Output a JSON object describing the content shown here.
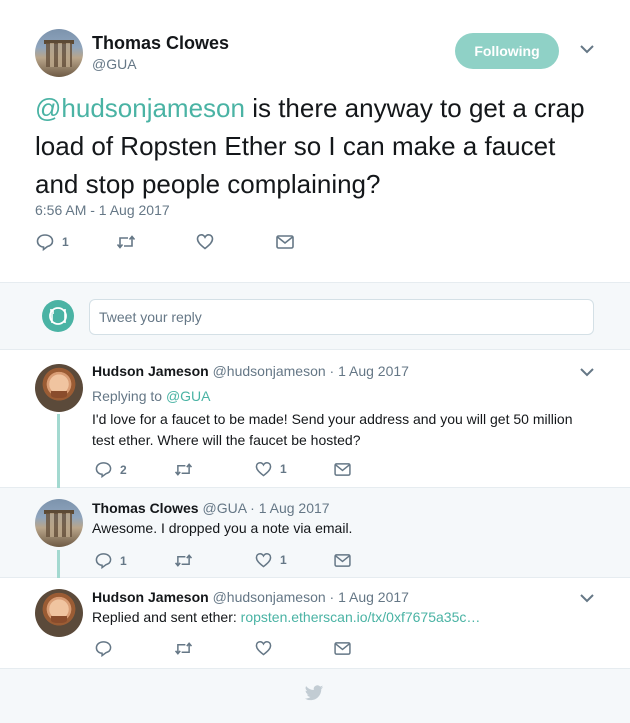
{
  "main_tweet": {
    "name": "Thomas Clowes",
    "handle": "@GUA",
    "follow_label": "Following",
    "mention": "@hudsonjameson",
    "text": " is there anyway to get a crap load of Ropsten Ether so I can make a faucet and stop people complaining?",
    "timestamp": "6:56 AM - 1 Aug 2017",
    "reply_count": "1"
  },
  "reply_box": {
    "placeholder": "Tweet your reply"
  },
  "replies": [
    {
      "name": "Hudson Jameson",
      "meta": "@hudsonjameson · 1 Aug 2017",
      "replying_prefix": "Replying to ",
      "replying_to": "@GUA",
      "text": "I'd love for a faucet to be made! Send your address and you will get 50 million test ether. Where will the faucet be hosted?",
      "reply_count": "2",
      "like_count": "1"
    },
    {
      "name": "Thomas Clowes",
      "meta": "@GUA · 1 Aug 2017",
      "text": "Awesome. I dropped you a note via email.",
      "reply_count": "1",
      "like_count": "1"
    },
    {
      "name": "Hudson Jameson",
      "meta": "@hudsonjameson · 1 Aug 2017",
      "text": "Replied and sent ether: ",
      "link": "ropsten.etherscan.io/tx/0xf7675a35c…"
    }
  ],
  "colors": {
    "accent": "#4ab3a4",
    "follow_bg": "#8fd1c6",
    "muted": "#657786",
    "thread": "#a3d9d0"
  },
  "icons": [
    "reply-icon",
    "retweet-icon",
    "like-icon",
    "dm-icon",
    "chevron-down-icon",
    "twitter-bird-icon"
  ]
}
